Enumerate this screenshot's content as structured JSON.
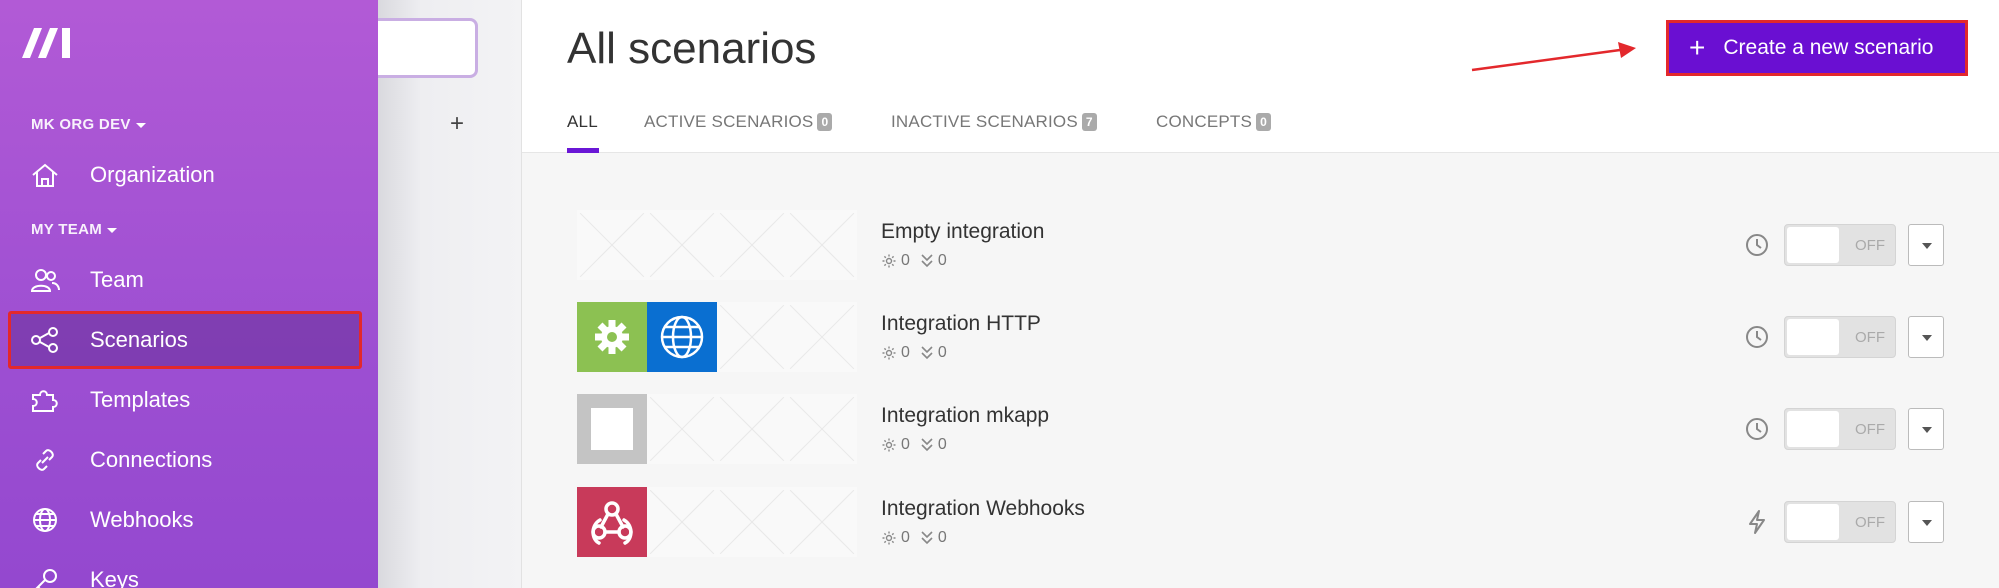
{
  "sidebar": {
    "org_label": "MK ORG DEV",
    "team_label": "MY TEAM",
    "items": [
      {
        "label": "Organization",
        "icon": "home-icon"
      },
      {
        "label": "Team",
        "icon": "users-icon"
      },
      {
        "label": "Scenarios",
        "icon": "share-icon"
      },
      {
        "label": "Templates",
        "icon": "puzzle-icon"
      },
      {
        "label": "Connections",
        "icon": "link-icon"
      },
      {
        "label": "Webhooks",
        "icon": "globe-icon"
      },
      {
        "label": "Keys",
        "icon": "key-icon"
      }
    ]
  },
  "second_column": {
    "add_symbol": "+"
  },
  "header": {
    "title": "All scenarios",
    "create_button": "Create a new scenario",
    "create_symbol": "+"
  },
  "tabs": [
    {
      "label": "ALL",
      "badge": ""
    },
    {
      "label": "ACTIVE SCENARIOS",
      "badge": "0"
    },
    {
      "label": "INACTIVE SCENARIOS",
      "badge": "7"
    },
    {
      "label": "CONCEPTS",
      "badge": "0"
    }
  ],
  "scenarios": [
    {
      "name": "Empty integration",
      "ops": "0",
      "transfer": "0",
      "trigger": "clock-icon",
      "status": "OFF"
    },
    {
      "name": "Integration HTTP",
      "ops": "0",
      "transfer": "0",
      "trigger": "clock-icon",
      "status": "OFF"
    },
    {
      "name": "Integration mkapp",
      "ops": "0",
      "transfer": "0",
      "trigger": "clock-icon",
      "status": "OFF"
    },
    {
      "name": "Integration Webhooks",
      "ops": "0",
      "transfer": "0",
      "trigger": "bolt-icon",
      "status": "OFF"
    }
  ],
  "colors": {
    "accent": "#6a0fd2",
    "highlight": "#e3282c",
    "http_green": "#8cc152",
    "http_blue": "#0a6fd1",
    "webhook_red": "#c83a5a"
  }
}
